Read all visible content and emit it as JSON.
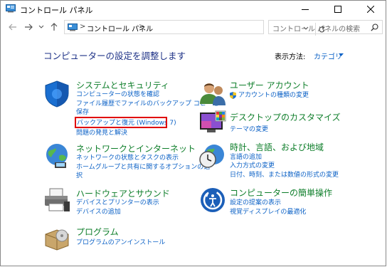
{
  "window": {
    "title": "コントロール パネル"
  },
  "address": {
    "separator": ">",
    "location": "コントロール パネル"
  },
  "search": {
    "placeholder": "コントロール パネルの検索"
  },
  "main": {
    "heading": "コンピューターの設定を調整します",
    "view_by_label": "表示方法:",
    "view_by_value": "カテゴリ"
  },
  "categories": {
    "system_security": {
      "title": "システムとセキュリティ",
      "links": [
        "コンピューターの状態を確認",
        "ファイル履歴でファイルのバックアップ コピーを",
        "保存",
        "バックアップと復元 (Windows 7)",
        "問題の発見と解決"
      ]
    },
    "network": {
      "title": "ネットワークとインターネット",
      "links": [
        "ネットワークの状態とタスクの表示",
        "ホームグループと共有に関するオプションの選",
        "択"
      ]
    },
    "hardware": {
      "title": "ハードウェアとサウンド",
      "links": [
        "デバイスとプリンターの表示",
        "デバイスの追加"
      ]
    },
    "programs": {
      "title": "プログラム",
      "links": [
        "プログラムのアンインストール"
      ]
    },
    "user_accounts": {
      "title": "ユーザー アカウント",
      "links": [
        "アカウントの種類の変更"
      ]
    },
    "appearance": {
      "title": "デスクトップのカスタマイズ",
      "links": [
        "テーマの変更"
      ]
    },
    "clock_region": {
      "title": "時計、言語、および地域",
      "links": [
        "言語の追加",
        "入力方式の変更",
        "日付、時刻、または数値の形式の変更"
      ]
    },
    "ease_of_access": {
      "title": "コンピューターの簡単操作",
      "links": [
        "設定の提案の表示",
        "視覚ディスプレイの最適化"
      ]
    }
  },
  "colors": {
    "link": "#0b61c6",
    "category_title": "#0e7e2a",
    "heading": "#1e3287",
    "highlight": "#e00000"
  }
}
